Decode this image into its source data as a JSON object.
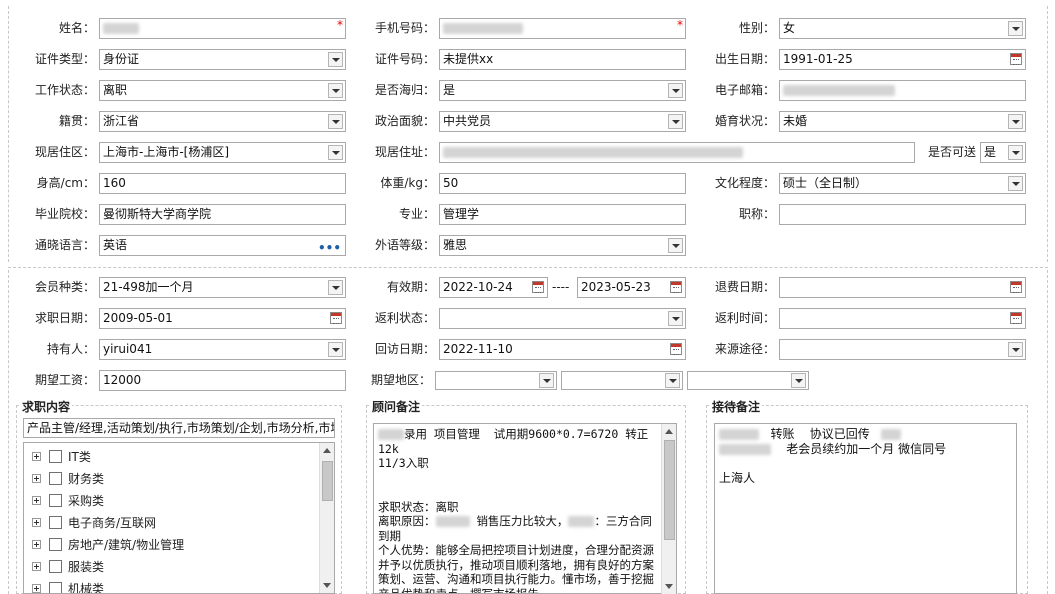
{
  "section1": {
    "name": {
      "label": "姓名：",
      "required": "*"
    },
    "phone": {
      "label": "手机号码：",
      "required": "*"
    },
    "gender": {
      "label": "性别：",
      "value": "女"
    },
    "id_type": {
      "label": "证件类型：",
      "value": "身份证"
    },
    "id_number": {
      "label": "证件号码：",
      "value": "未提供xx"
    },
    "birthdate": {
      "label": "出生日期：",
      "value": "1991-01-25"
    },
    "work_status": {
      "label": "工作状态：",
      "value": "离职"
    },
    "overseas": {
      "label": "是否海归：",
      "value": "是"
    },
    "email": {
      "label": "电子邮箱："
    },
    "native_place": {
      "label": "籍贯：",
      "value": "浙江省"
    },
    "political": {
      "label": "政治面貌：",
      "value": "中共党员"
    },
    "marital": {
      "label": "婚育状况：",
      "value": "未婚"
    },
    "current_area": {
      "label": "现居住区：",
      "value": "上海市-上海市-[杨浦区]"
    },
    "current_address": {
      "label": "现居住址："
    },
    "reachable": {
      "label": "是否可送",
      "value": "是"
    },
    "height": {
      "label": "身高/cm：",
      "value": "160"
    },
    "weight": {
      "label": "体重/kg：",
      "value": "50"
    },
    "education": {
      "label": "文化程度：",
      "value": "硕士（全日制）"
    },
    "school": {
      "label": "毕业院校：",
      "value": "曼彻斯特大学商学院"
    },
    "major": {
      "label": "专业：",
      "value": "管理学"
    },
    "title": {
      "label": "职称：",
      "value": ""
    },
    "language": {
      "label": "通晓语言：",
      "value": "英语",
      "more": "•••"
    },
    "language_level": {
      "label": "外语等级：",
      "value": "雅思"
    }
  },
  "section2": {
    "member_type": {
      "label": "会员种类：",
      "value": "21-498加一个月"
    },
    "valid_period": {
      "label": "有效期：",
      "start": "2022-10-24",
      "sep": "----",
      "end": "2023-05-23"
    },
    "refund_date": {
      "label": "退费日期：",
      "value": ""
    },
    "apply_date": {
      "label": "求职日期：",
      "value": "2009-05-01"
    },
    "rebate_status": {
      "label": "返利状态：",
      "value": ""
    },
    "rebate_time": {
      "label": "返利时间：",
      "value": ""
    },
    "holder": {
      "label": "持有人：",
      "value": "yirui041"
    },
    "visit_date": {
      "label": "回访日期：",
      "value": "2022-11-10"
    },
    "source": {
      "label": "来源途径：",
      "value": ""
    },
    "expected_salary": {
      "label": "期望工资：",
      "value": "12000"
    },
    "expected_area": {
      "label": "期望地区：",
      "values": [
        "",
        "",
        ""
      ]
    }
  },
  "job_content": {
    "title": "求职内容",
    "summary": "产品主管/经理,活动策划/执行,市场策划/企划,市场分析,市场",
    "tree": [
      "IT类",
      "财务类",
      "采购类",
      "电子商务/互联网",
      "房地产/建筑/物业管理",
      "服装类",
      "机械类"
    ]
  },
  "consultant_notes": {
    "title": "顾问备注",
    "line1": "录用 项目管理  试用期9600*0.7=6720 转正12k",
    "line2": "11/3入职",
    "line3": "求职状态：离职",
    "line4a": "离职原因：",
    "line4b": "销售压力比较大，",
    "line4c": "：三方合同",
    "line5": "到期",
    "line6": "个人优势：能够全局把控项目计划进度，合理分配资源并予以优质执行，推动项目顺利落地，拥有良好的方案策划、运营、沟通和项目执行能力。懂市场，善于挖掘产品优势和卖点，撰写市场报告"
  },
  "reception_notes": {
    "title": "接待备注",
    "line1a": "转账",
    "line1b": "协议已回传",
    "line2": "老会员续约加一个月 微信同号",
    "line3": "上海人"
  }
}
